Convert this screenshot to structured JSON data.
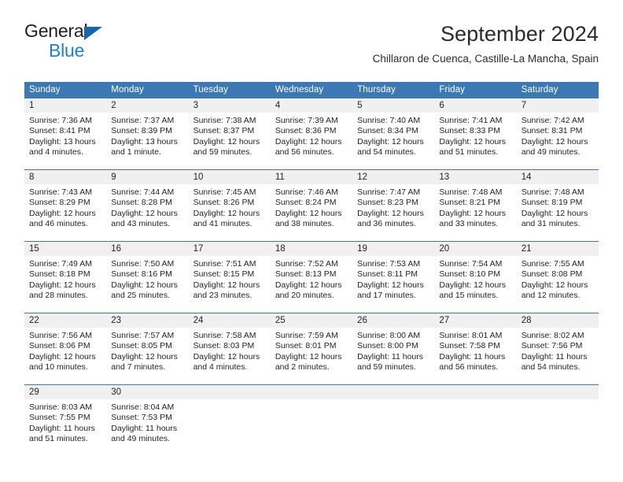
{
  "brand": {
    "name_part1": "General",
    "name_part2": "Blue",
    "accent_color": "#1b7fd4",
    "triangle_color": "#1666b0"
  },
  "header": {
    "title": "September 2024",
    "subtitle": "Chillaron de Cuenca, Castille-La Mancha, Spain"
  },
  "calendar": {
    "header_bg": "#3c78b4",
    "daynum_bg": "#f0f0f0",
    "weekdays": [
      "Sunday",
      "Monday",
      "Tuesday",
      "Wednesday",
      "Thursday",
      "Friday",
      "Saturday"
    ],
    "weeks": [
      [
        {
          "day": "1",
          "sunrise": "Sunrise: 7:36 AM",
          "sunset": "Sunset: 8:41 PM",
          "daylight_line1": "Daylight: 13 hours",
          "daylight_line2": "and 4 minutes."
        },
        {
          "day": "2",
          "sunrise": "Sunrise: 7:37 AM",
          "sunset": "Sunset: 8:39 PM",
          "daylight_line1": "Daylight: 13 hours",
          "daylight_line2": "and 1 minute."
        },
        {
          "day": "3",
          "sunrise": "Sunrise: 7:38 AM",
          "sunset": "Sunset: 8:37 PM",
          "daylight_line1": "Daylight: 12 hours",
          "daylight_line2": "and 59 minutes."
        },
        {
          "day": "4",
          "sunrise": "Sunrise: 7:39 AM",
          "sunset": "Sunset: 8:36 PM",
          "daylight_line1": "Daylight: 12 hours",
          "daylight_line2": "and 56 minutes."
        },
        {
          "day": "5",
          "sunrise": "Sunrise: 7:40 AM",
          "sunset": "Sunset: 8:34 PM",
          "daylight_line1": "Daylight: 12 hours",
          "daylight_line2": "and 54 minutes."
        },
        {
          "day": "6",
          "sunrise": "Sunrise: 7:41 AM",
          "sunset": "Sunset: 8:33 PM",
          "daylight_line1": "Daylight: 12 hours",
          "daylight_line2": "and 51 minutes."
        },
        {
          "day": "7",
          "sunrise": "Sunrise: 7:42 AM",
          "sunset": "Sunset: 8:31 PM",
          "daylight_line1": "Daylight: 12 hours",
          "daylight_line2": "and 49 minutes."
        }
      ],
      [
        {
          "day": "8",
          "sunrise": "Sunrise: 7:43 AM",
          "sunset": "Sunset: 8:29 PM",
          "daylight_line1": "Daylight: 12 hours",
          "daylight_line2": "and 46 minutes."
        },
        {
          "day": "9",
          "sunrise": "Sunrise: 7:44 AM",
          "sunset": "Sunset: 8:28 PM",
          "daylight_line1": "Daylight: 12 hours",
          "daylight_line2": "and 43 minutes."
        },
        {
          "day": "10",
          "sunrise": "Sunrise: 7:45 AM",
          "sunset": "Sunset: 8:26 PM",
          "daylight_line1": "Daylight: 12 hours",
          "daylight_line2": "and 41 minutes."
        },
        {
          "day": "11",
          "sunrise": "Sunrise: 7:46 AM",
          "sunset": "Sunset: 8:24 PM",
          "daylight_line1": "Daylight: 12 hours",
          "daylight_line2": "and 38 minutes."
        },
        {
          "day": "12",
          "sunrise": "Sunrise: 7:47 AM",
          "sunset": "Sunset: 8:23 PM",
          "daylight_line1": "Daylight: 12 hours",
          "daylight_line2": "and 36 minutes."
        },
        {
          "day": "13",
          "sunrise": "Sunrise: 7:48 AM",
          "sunset": "Sunset: 8:21 PM",
          "daylight_line1": "Daylight: 12 hours",
          "daylight_line2": "and 33 minutes."
        },
        {
          "day": "14",
          "sunrise": "Sunrise: 7:48 AM",
          "sunset": "Sunset: 8:19 PM",
          "daylight_line1": "Daylight: 12 hours",
          "daylight_line2": "and 31 minutes."
        }
      ],
      [
        {
          "day": "15",
          "sunrise": "Sunrise: 7:49 AM",
          "sunset": "Sunset: 8:18 PM",
          "daylight_line1": "Daylight: 12 hours",
          "daylight_line2": "and 28 minutes."
        },
        {
          "day": "16",
          "sunrise": "Sunrise: 7:50 AM",
          "sunset": "Sunset: 8:16 PM",
          "daylight_line1": "Daylight: 12 hours",
          "daylight_line2": "and 25 minutes."
        },
        {
          "day": "17",
          "sunrise": "Sunrise: 7:51 AM",
          "sunset": "Sunset: 8:15 PM",
          "daylight_line1": "Daylight: 12 hours",
          "daylight_line2": "and 23 minutes."
        },
        {
          "day": "18",
          "sunrise": "Sunrise: 7:52 AM",
          "sunset": "Sunset: 8:13 PM",
          "daylight_line1": "Daylight: 12 hours",
          "daylight_line2": "and 20 minutes."
        },
        {
          "day": "19",
          "sunrise": "Sunrise: 7:53 AM",
          "sunset": "Sunset: 8:11 PM",
          "daylight_line1": "Daylight: 12 hours",
          "daylight_line2": "and 17 minutes."
        },
        {
          "day": "20",
          "sunrise": "Sunrise: 7:54 AM",
          "sunset": "Sunset: 8:10 PM",
          "daylight_line1": "Daylight: 12 hours",
          "daylight_line2": "and 15 minutes."
        },
        {
          "day": "21",
          "sunrise": "Sunrise: 7:55 AM",
          "sunset": "Sunset: 8:08 PM",
          "daylight_line1": "Daylight: 12 hours",
          "daylight_line2": "and 12 minutes."
        }
      ],
      [
        {
          "day": "22",
          "sunrise": "Sunrise: 7:56 AM",
          "sunset": "Sunset: 8:06 PM",
          "daylight_line1": "Daylight: 12 hours",
          "daylight_line2": "and 10 minutes."
        },
        {
          "day": "23",
          "sunrise": "Sunrise: 7:57 AM",
          "sunset": "Sunset: 8:05 PM",
          "daylight_line1": "Daylight: 12 hours",
          "daylight_line2": "and 7 minutes."
        },
        {
          "day": "24",
          "sunrise": "Sunrise: 7:58 AM",
          "sunset": "Sunset: 8:03 PM",
          "daylight_line1": "Daylight: 12 hours",
          "daylight_line2": "and 4 minutes."
        },
        {
          "day": "25",
          "sunrise": "Sunrise: 7:59 AM",
          "sunset": "Sunset: 8:01 PM",
          "daylight_line1": "Daylight: 12 hours",
          "daylight_line2": "and 2 minutes."
        },
        {
          "day": "26",
          "sunrise": "Sunrise: 8:00 AM",
          "sunset": "Sunset: 8:00 PM",
          "daylight_line1": "Daylight: 11 hours",
          "daylight_line2": "and 59 minutes."
        },
        {
          "day": "27",
          "sunrise": "Sunrise: 8:01 AM",
          "sunset": "Sunset: 7:58 PM",
          "daylight_line1": "Daylight: 11 hours",
          "daylight_line2": "and 56 minutes."
        },
        {
          "day": "28",
          "sunrise": "Sunrise: 8:02 AM",
          "sunset": "Sunset: 7:56 PM",
          "daylight_line1": "Daylight: 11 hours",
          "daylight_line2": "and 54 minutes."
        }
      ],
      [
        {
          "day": "29",
          "sunrise": "Sunrise: 8:03 AM",
          "sunset": "Sunset: 7:55 PM",
          "daylight_line1": "Daylight: 11 hours",
          "daylight_line2": "and 51 minutes."
        },
        {
          "day": "30",
          "sunrise": "Sunrise: 8:04 AM",
          "sunset": "Sunset: 7:53 PM",
          "daylight_line1": "Daylight: 11 hours",
          "daylight_line2": "and 49 minutes."
        },
        {
          "day": "",
          "sunrise": "",
          "sunset": "",
          "daylight_line1": "",
          "daylight_line2": ""
        },
        {
          "day": "",
          "sunrise": "",
          "sunset": "",
          "daylight_line1": "",
          "daylight_line2": ""
        },
        {
          "day": "",
          "sunrise": "",
          "sunset": "",
          "daylight_line1": "",
          "daylight_line2": ""
        },
        {
          "day": "",
          "sunrise": "",
          "sunset": "",
          "daylight_line1": "",
          "daylight_line2": ""
        },
        {
          "day": "",
          "sunrise": "",
          "sunset": "",
          "daylight_line1": "",
          "daylight_line2": ""
        }
      ]
    ]
  }
}
